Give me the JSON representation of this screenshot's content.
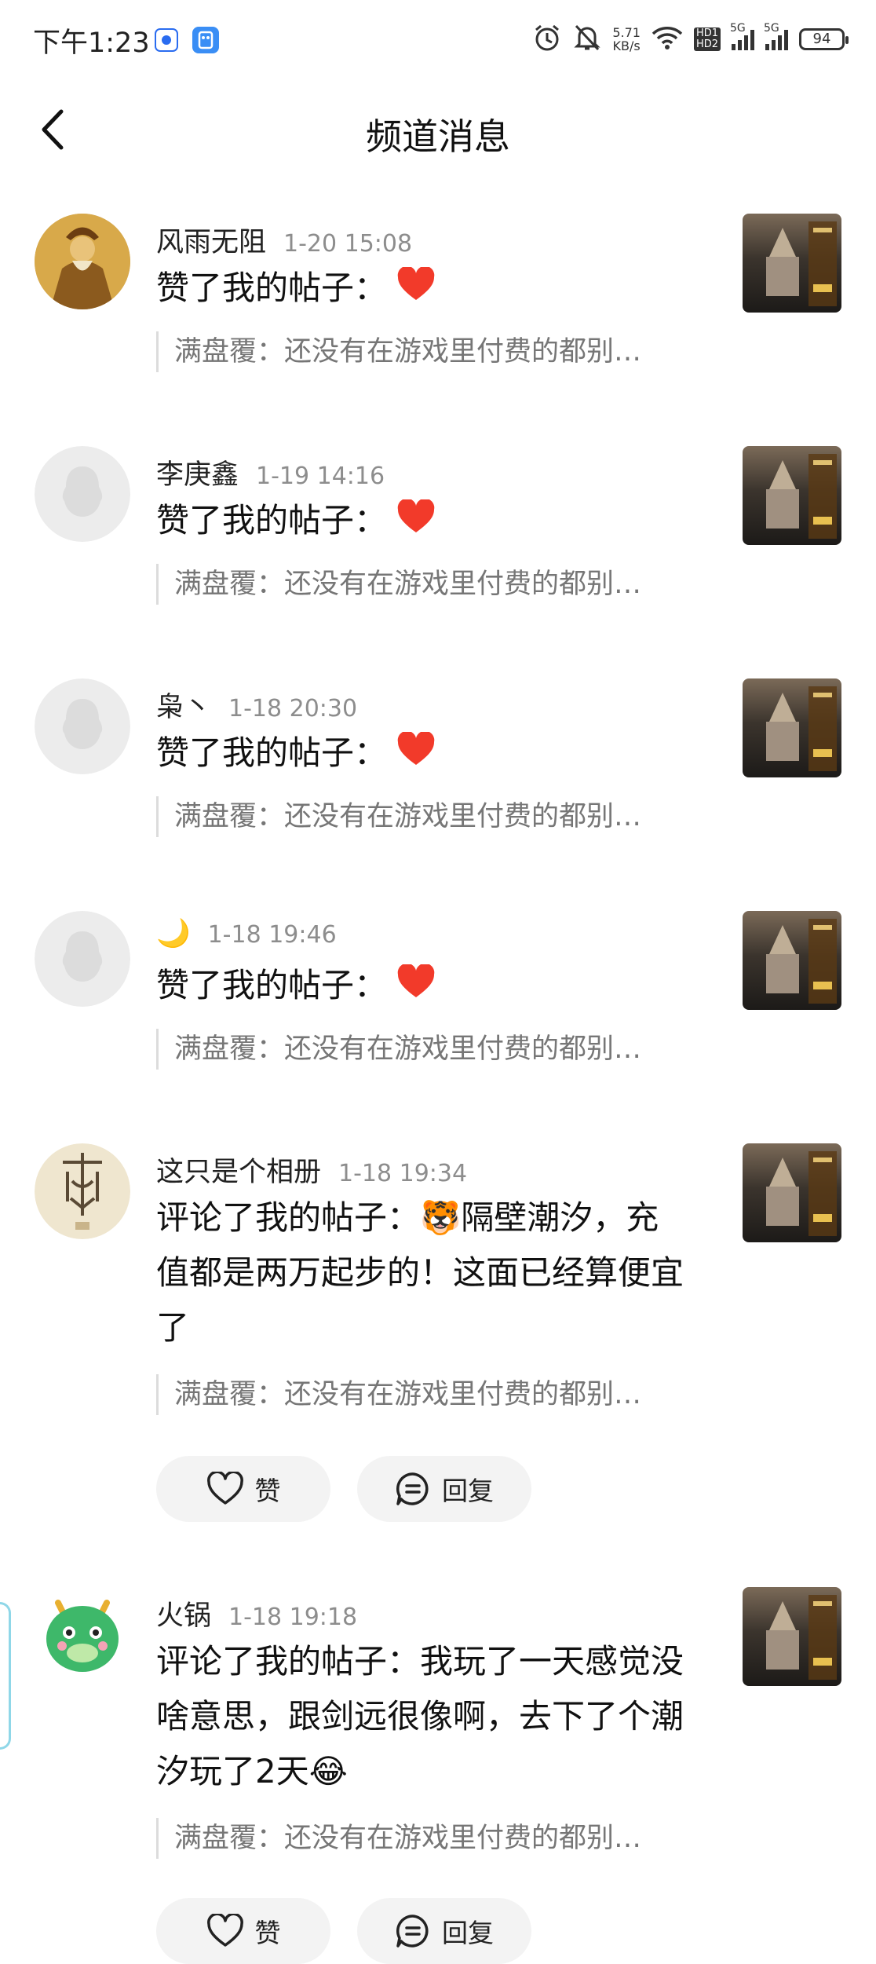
{
  "status_bar": {
    "time": "下午1:23",
    "net_speed_value": "5.71",
    "net_speed_unit": "KB/s",
    "hd_label_1": "HD1",
    "hd_label_2": "HD2",
    "signal1_label": "5G",
    "signal2_label": "5G",
    "battery": "94",
    "icons": [
      "app-circle-icon",
      "app-square-icon",
      "alarm-icon",
      "mute-bell-icon",
      "wifi-icon",
      "signal-icon",
      "signal-icon",
      "battery-icon"
    ]
  },
  "header": {
    "title": "频道消息",
    "back_icon": "chevron-left-icon"
  },
  "messages": [
    {
      "user": "风雨无阻",
      "time": "1-20 15:08",
      "action": "赞了我的帖子：",
      "type": "like",
      "quote": "满盘覆：还没有在游戏里付费的都别…",
      "avatar": "warrior"
    },
    {
      "user": "李庚鑫",
      "time": "1-19 14:16",
      "action": "赞了我的帖子：",
      "type": "like",
      "quote": "满盘覆：还没有在游戏里付费的都别…",
      "avatar": "default"
    },
    {
      "user": "枭丶",
      "time": "1-18 20:30",
      "action": "赞了我的帖子：",
      "type": "like",
      "quote": "满盘覆：还没有在游戏里付费的都别…",
      "avatar": "default"
    },
    {
      "user": "🌙",
      "time": "1-18 19:46",
      "action": "赞了我的帖子：",
      "type": "like",
      "quote": "满盘覆：还没有在游戏里付费的都别…",
      "avatar": "default"
    },
    {
      "user": "这只是个相册",
      "time": "1-18 19:34",
      "action": "评论了我的帖子：",
      "type": "comment",
      "comment": "🐯隔壁潮汐，充值都是两万起步的！这面已经算便宜了",
      "quote": "满盘覆：还没有在游戏里付费的都别…",
      "avatar": "glyph",
      "like_label": "赞",
      "reply_label": "回复"
    },
    {
      "user": "火锅",
      "time": "1-18 19:18",
      "action": "评论了我的帖子：",
      "type": "comment",
      "comment": "我玩了一天感觉没啥意思，跟剑远很像啊，去下了个潮汐玩了2天😂",
      "quote": "满盘覆：还没有在游戏里付费的都别…",
      "avatar": "dragon",
      "like_label": "赞",
      "reply_label": "回复"
    }
  ],
  "colors": {
    "heart": "#f23a2a",
    "time": "#8d8d8d",
    "quote": "#767676",
    "pill_bg": "#f3f3f3",
    "default_avatar_bg": "#ececec"
  }
}
